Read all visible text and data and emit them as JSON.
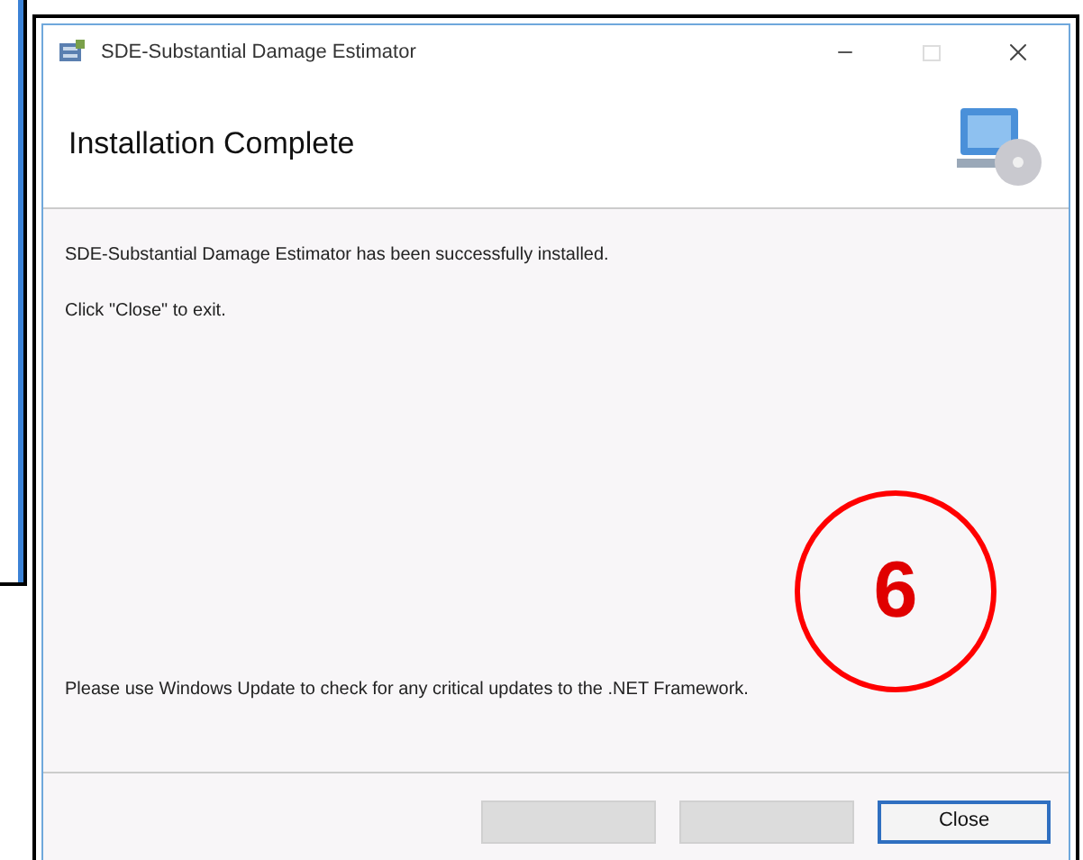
{
  "window": {
    "title": "SDE-Substantial Damage Estimator"
  },
  "header": {
    "title": "Installation Complete"
  },
  "body": {
    "messages": [
      "SDE-Substantial Damage Estimator has been successfully installed.",
      "Click \"Close\" to exit."
    ],
    "note": "Please use Windows Update to check for any critical updates to the .NET Framework."
  },
  "buttons": [
    {
      "disabled": true
    },
    {
      "disabled": true
    },
    {
      "label": "Close",
      "disabled": false
    }
  ],
  "annotation": {
    "label": "6"
  }
}
